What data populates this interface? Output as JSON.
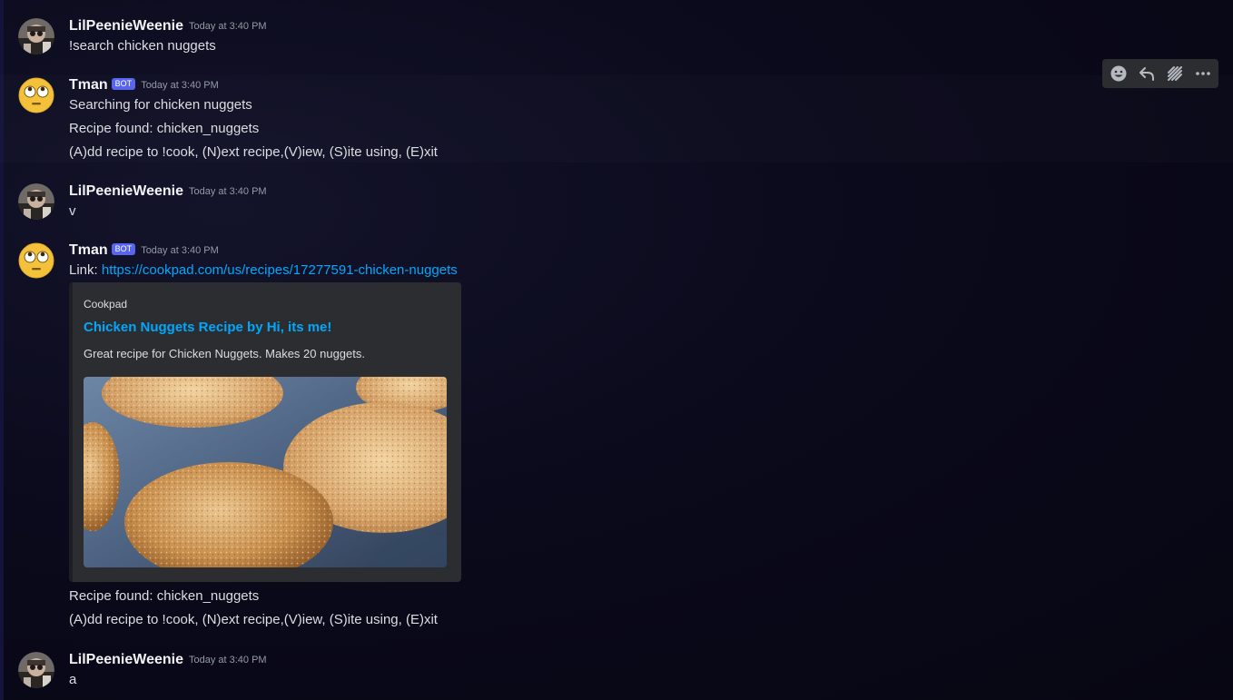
{
  "messages": [
    {
      "username": "LilPeenieWeenie",
      "timestamp": "Today at 3:40 PM",
      "lines": [
        "!search chicken nuggets"
      ]
    },
    {
      "username": "Tman",
      "bot_tag": "BOT",
      "timestamp": "Today at 3:40 PM",
      "lines": [
        "Searching for chicken nuggets",
        "Recipe found: chicken_nuggets",
        "(A)dd recipe to !cook, (N)ext recipe,(V)iew, (S)ite using, (E)xit"
      ]
    },
    {
      "username": "LilPeenieWeenie",
      "timestamp": "Today at 3:40 PM",
      "lines": [
        "v"
      ]
    },
    {
      "username": "Tman",
      "bot_tag": "BOT",
      "timestamp": "Today at 3:40 PM",
      "link_prefix": "Link: ",
      "link_url": "https://cookpad.com/us/recipes/17277591-chicken-nuggets",
      "embed": {
        "provider": "Cookpad",
        "title": "Chicken Nuggets Recipe by Hi, its me!",
        "description": "Great recipe for Chicken Nuggets. Makes 20 nuggets.",
        "image": "chicken-nuggets-photo"
      },
      "lines_after": [
        "Recipe found: chicken_nuggets",
        "(A)dd recipe to !cook, (N)ext recipe,(V)iew, (S)ite using, (E)xit"
      ]
    },
    {
      "username": "LilPeenieWeenie",
      "timestamp": "Today at 3:40 PM",
      "lines": [
        "a"
      ]
    }
  ],
  "toolbar": {
    "buttons": [
      "add-reaction-icon",
      "reply-icon",
      "create-thread-icon",
      "more-options-icon"
    ]
  },
  "colors": {
    "background": "#0b0a1c",
    "text": "#dbdee1",
    "username": "#f2f3f5",
    "timestamp": "#949ba4",
    "link": "#00a8fc",
    "bot_tag": "#5865f2",
    "embed_bg": "#2b2d31"
  }
}
